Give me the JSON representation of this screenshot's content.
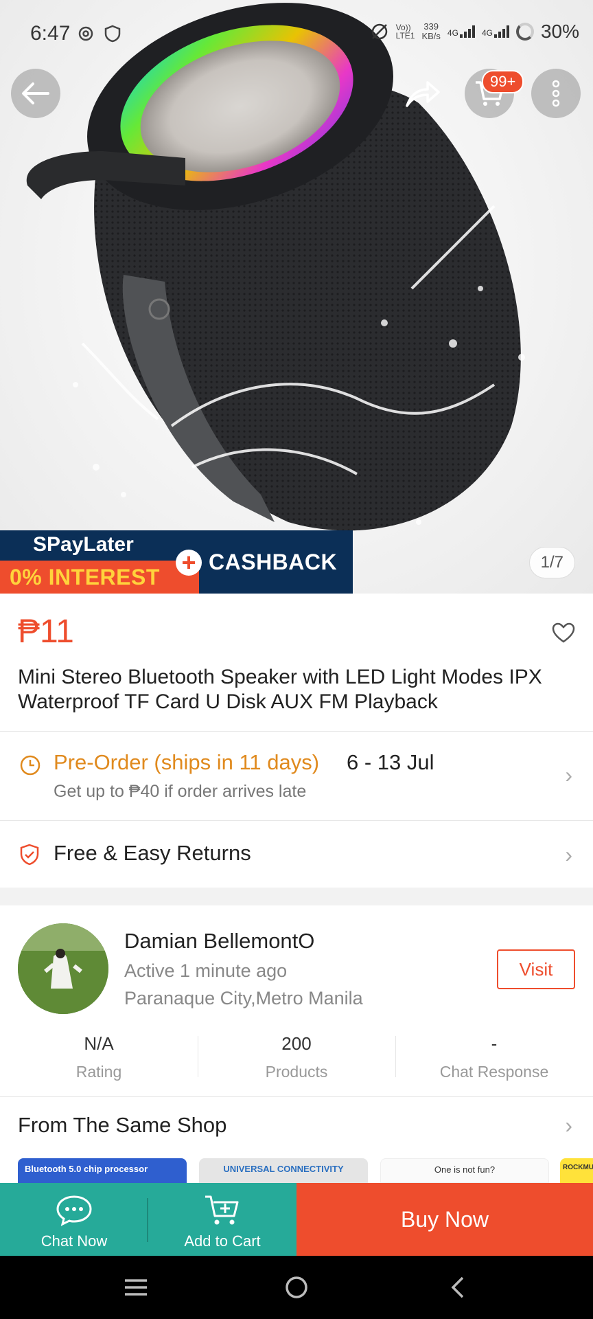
{
  "status_bar": {
    "time": "6:47",
    "net_speed_value": "339",
    "net_speed_unit": "KB/s",
    "volte_top": "Vo))",
    "volte_bottom": "LTE1",
    "signal1_label": "4G",
    "signal2_label": "4G",
    "battery": "30%"
  },
  "header": {
    "cart_badge": "99+"
  },
  "promo": {
    "spaylater": "SPayLater",
    "interest": "0% INTEREST",
    "cashback": "CASHBACK",
    "image_counter": "1/7"
  },
  "product": {
    "price": "₱11",
    "title": "Mini Stereo Bluetooth Speaker with LED Light Modes IPX Waterproof TF Card U Disk AUX FM Playback"
  },
  "shipping": {
    "preorder_label": "Pre-Order (ships in 11 days)",
    "dates": "6 - 13 Jul",
    "late_note": "Get up to ₱40 if order arrives late"
  },
  "returns": {
    "label": "Free & Easy Returns"
  },
  "shop": {
    "name": "Damian BellemontO",
    "active": "Active 1 minute ago",
    "location": "Paranaque City,Metro Manila",
    "visit_label": "Visit",
    "stats": [
      {
        "value": "N/A",
        "label": "Rating"
      },
      {
        "value": "200",
        "label": "Products"
      },
      {
        "value": "-",
        "label": "Chat Response"
      }
    ]
  },
  "same_shop": {
    "title": "From The Same Shop",
    "thumbs": [
      "Bluetooth 5.0 chip processor",
      "UNIVERSAL CONNECTIVITY",
      "One is not fun?",
      "ROCKMU"
    ]
  },
  "actions": {
    "chat_now": "Chat Now",
    "add_to_cart": "Add to Cart",
    "buy_now": "Buy Now"
  },
  "colors": {
    "brand_orange": "#ee4d2d",
    "teal": "#26aa99",
    "preorder_orange": "#e08a1e"
  }
}
